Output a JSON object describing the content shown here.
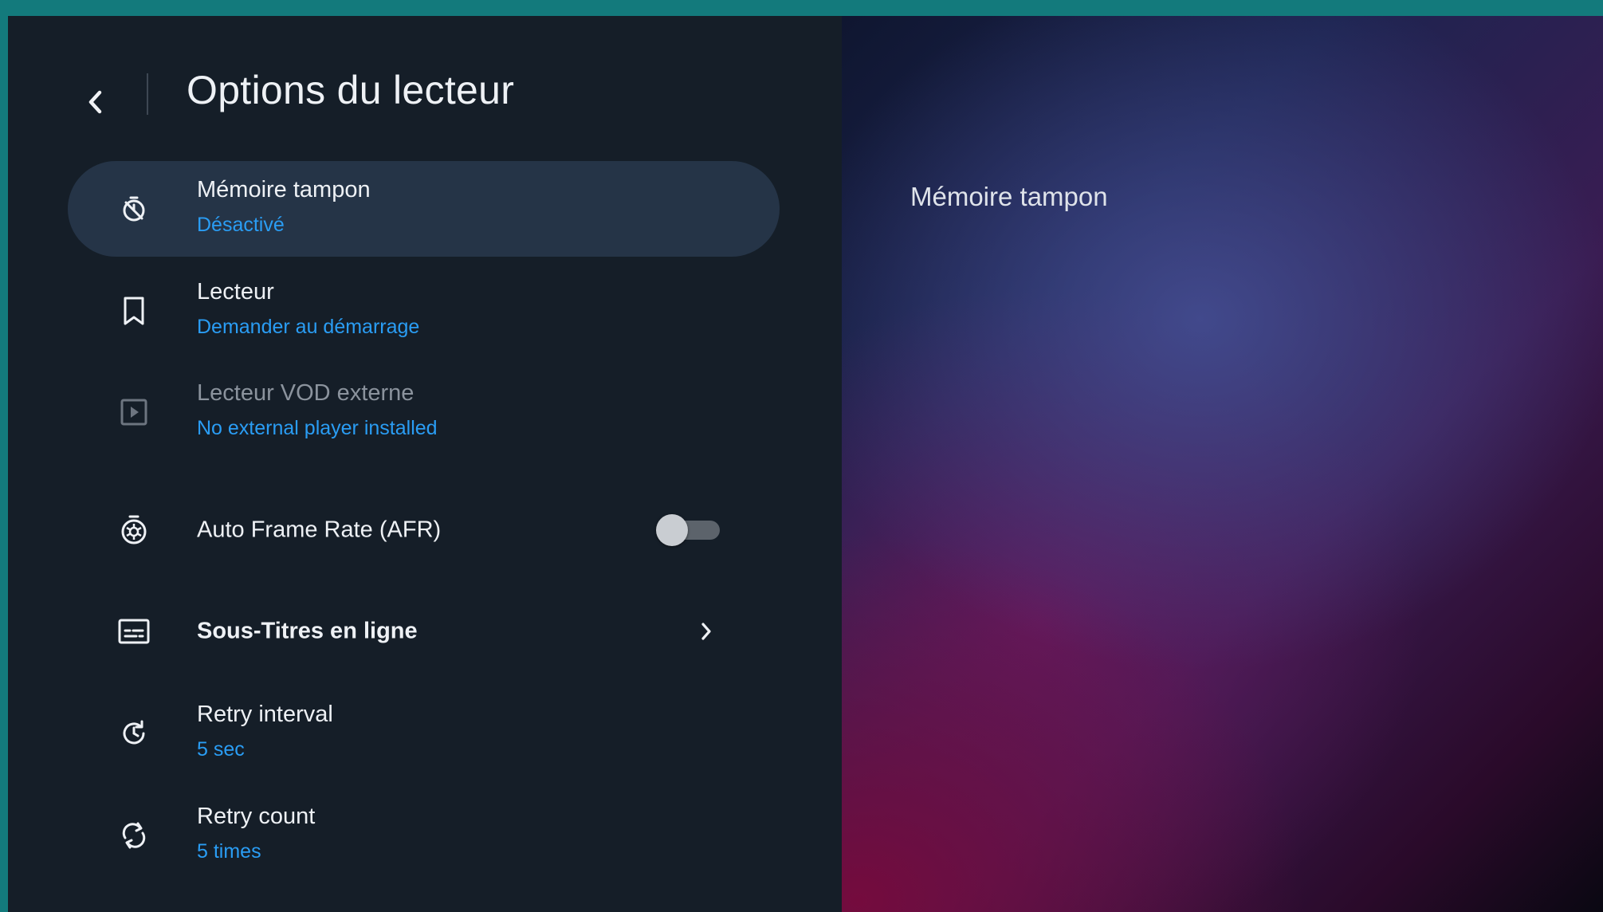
{
  "header": {
    "title": "Options du lecteur"
  },
  "settings": {
    "items": [
      {
        "label": "Mémoire tampon",
        "value": "Désactivé",
        "icon": "timer-off-icon",
        "focused": true
      },
      {
        "label": "Lecteur",
        "value": "Demander au démarrage",
        "icon": "bookmark-icon"
      },
      {
        "label": "Lecteur VOD externe",
        "value": "No external player installed",
        "icon": "play-box-icon",
        "disabled": true
      },
      {
        "label": "Auto Frame Rate (AFR)",
        "icon": "shutter-icon",
        "toggle": false
      },
      {
        "label": "Sous-Titres en ligne",
        "icon": "subtitles-icon",
        "has_submenu": true
      },
      {
        "label": "Retry interval",
        "value": "5 sec",
        "icon": "clock-refresh-icon"
      },
      {
        "label": "Retry count",
        "value": "5 times",
        "icon": "sync-icon"
      }
    ]
  },
  "detail": {
    "title": "Mémoire tampon"
  },
  "colors": {
    "accent": "#2a9df4",
    "panel_bg": "#151e28",
    "focus_bg": "#253447",
    "frame": "#137a7c"
  }
}
